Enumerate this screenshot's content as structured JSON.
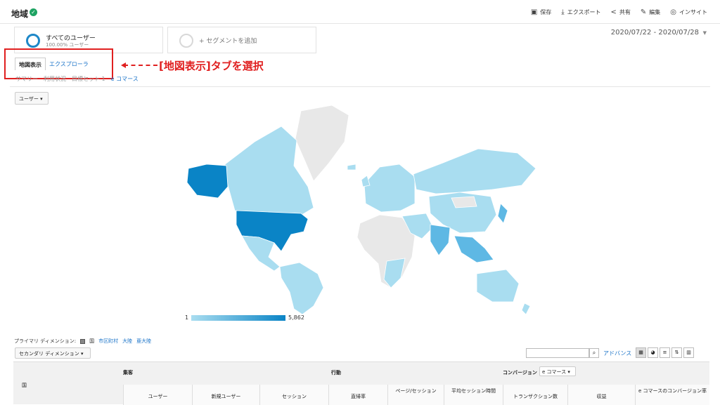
{
  "header": {
    "title": "地域",
    "toolbar": {
      "save": "保存",
      "export": "エクスポート",
      "share": "共有",
      "edit": "編集",
      "insight": "インサイト"
    }
  },
  "segments": [
    {
      "name": "すべてのユーザー",
      "sub": "100.00% ユーザー"
    },
    {
      "name": "+ セグメントを追加"
    }
  ],
  "date_range": "2020/07/22 - 2020/07/28",
  "tabs": [
    "地図表示",
    "エクスプローラ"
  ],
  "annotation": "[地図表示]タブを選択",
  "subnav": [
    "サマリー",
    "利用状況",
    "目標セット 1",
    "e コマース"
  ],
  "metric_select": "ユーザー",
  "legend": {
    "min": "1",
    "max": "5,862"
  },
  "colors": {
    "high": "#0a84c6",
    "mid": "#5eb8e4",
    "low": "#a9ddf0",
    "none": "#e8e8e8",
    "annotation": "#e02020",
    "link": "#1a73c8"
  },
  "primary_dimension": {
    "label": "プライマリ ディメンション:",
    "options": [
      "国",
      "市区町村",
      "大陸",
      "亜大陸"
    ]
  },
  "secondary_dimension": "セカンダリ ディメンション",
  "advanced": "アドバンス",
  "table": {
    "country_header": "国",
    "groups": [
      "集客",
      "行動",
      "コンバージョン"
    ],
    "conversion_select": "e コマース",
    "columns": [
      "ユーザー",
      "新規ユーザー",
      "セッション",
      "直帰率",
      "ページ/セッション",
      "平均セッション時間",
      "トランザクション数",
      "収益",
      "e コマースのコンバージョン率"
    ]
  }
}
